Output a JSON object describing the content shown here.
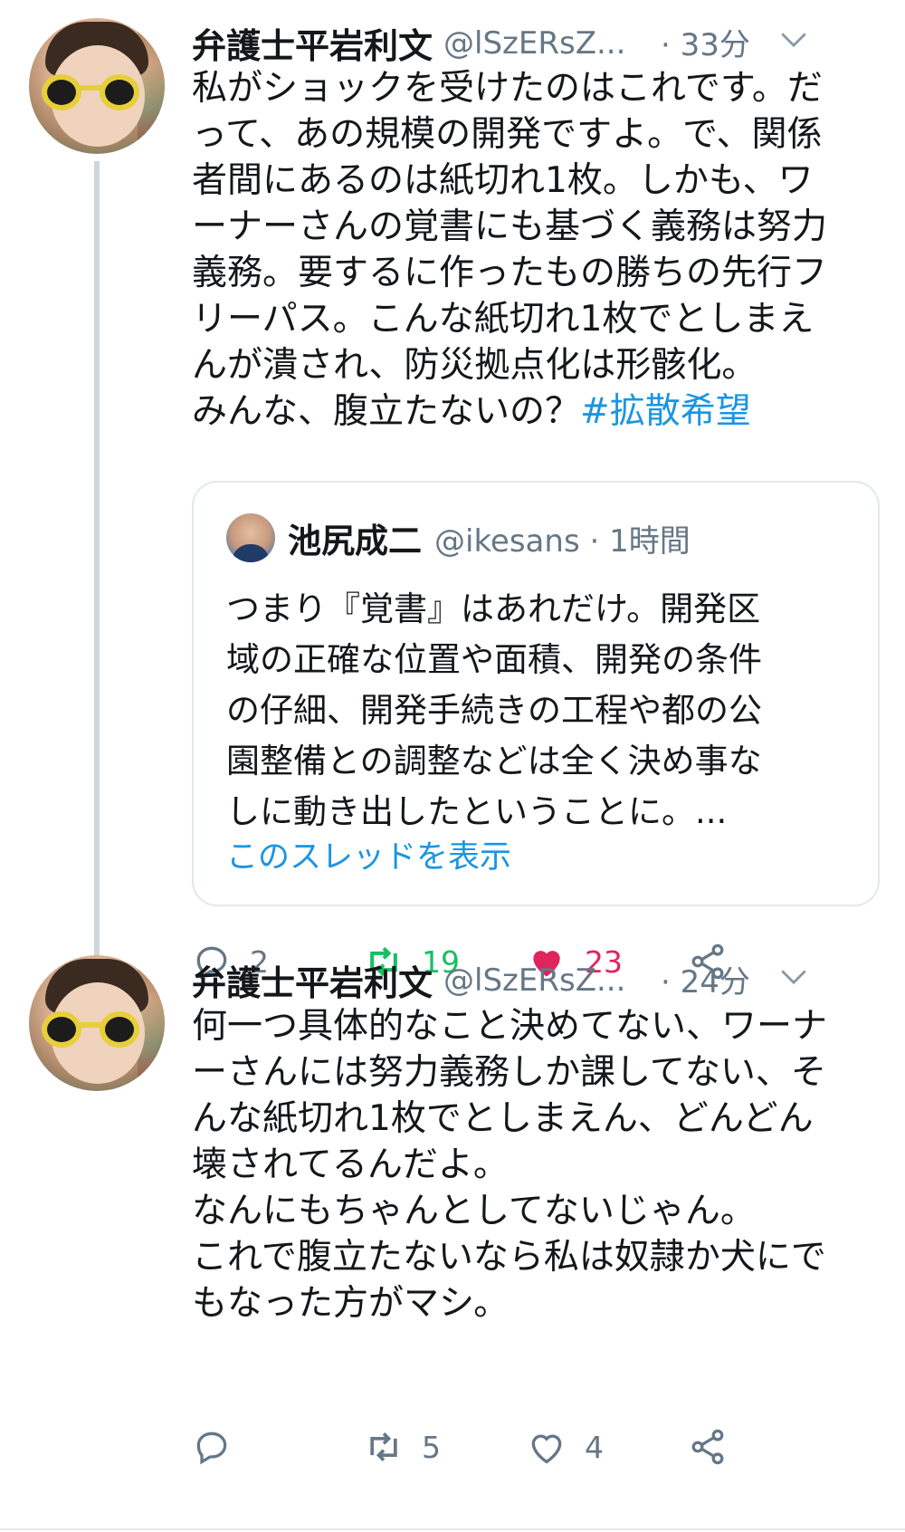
{
  "tweet1": {
    "name": "弁護士平岩利文",
    "handle": "@lSzERsZ...",
    "time": "· 33分",
    "lines": [
      "私がショックを受けたのはこれです。だ",
      "って、あの規模の開発ですよ。で、関係",
      "者間にあるのは紙切れ1枚。しかも、ワ",
      "ーナーさんの覚書にも基づく義務は努力",
      "義務。要するに作ったもの勝ちの先行フ",
      "リーパス。こんな紙切れ1枚でとしまえ",
      "んが潰され、防災拠点化は形骸化。"
    ],
    "last_line": "みんな、腹立たないの？",
    "hashtag": "#拡散希望",
    "quote": {
      "name": "池尻成二",
      "meta": "@ikesans · 1時間",
      "lines": [
        "つまり『覚書』はあれだけ。開発区",
        "域の正確な位置や面積、開発の条件",
        "の仔細、開発手続きの工程や都の公",
        "園整備との調整などは全く決め事な",
        "しに動き出したということに。..."
      ],
      "link": "このスレッドを表示"
    },
    "actions": {
      "replies": "2",
      "retweets": "19",
      "likes": "23"
    }
  },
  "tweet2": {
    "name": "弁護士平岩利文",
    "handle": "@lSzERsZ...",
    "time": "· 24分",
    "lines": [
      "何一つ具体的なこと決めてない、ワーナ",
      "ーさんには努力義務しか課してない、そ",
      "んな紙切れ1枚でとしまえん、どんどん",
      "壊されてるんだよ。",
      "なんにもちゃんとしてないじゃん。",
      "これで腹立たないなら私は奴隷か犬にで",
      "もなった方がマシ。"
    ],
    "actions": {
      "replies": "",
      "retweets": "5",
      "likes": "4"
    }
  },
  "colors": {
    "link": "#1b95e0",
    "retweet": "#17bf63",
    "like": "#e0245e",
    "muted": "#657786"
  }
}
